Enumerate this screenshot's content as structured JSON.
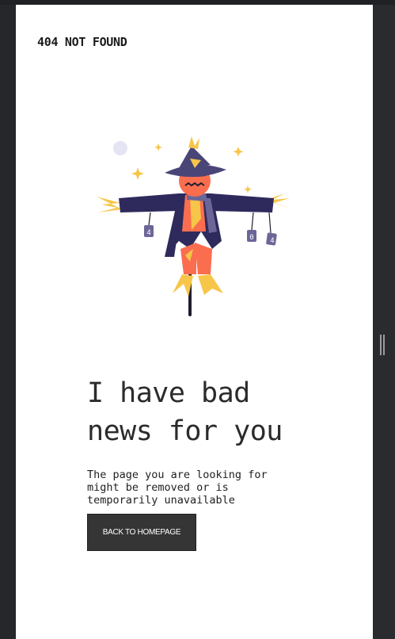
{
  "header": {
    "brand": "404 NOT FOUND"
  },
  "hero": {
    "headline_line1": "I have bad",
    "headline_line2": "news for you",
    "description": "The page you are looking for might be removed or is temporarily unavailable",
    "cta_label": "BACK TO HOMEPAGE"
  },
  "illustration": {
    "icon": "scarecrow-illustration",
    "can_labels": [
      "4",
      "0",
      "4"
    ]
  },
  "colors": {
    "page_bg": "#ffffff",
    "chrome_bg": "#26272b",
    "text": "#2b2b2b",
    "button_bg": "#353535",
    "scarecrow_hat": "#4a4577",
    "scarecrow_face": "#fa6e4f",
    "straw": "#f7c548",
    "coat": "#2e2a5c"
  }
}
